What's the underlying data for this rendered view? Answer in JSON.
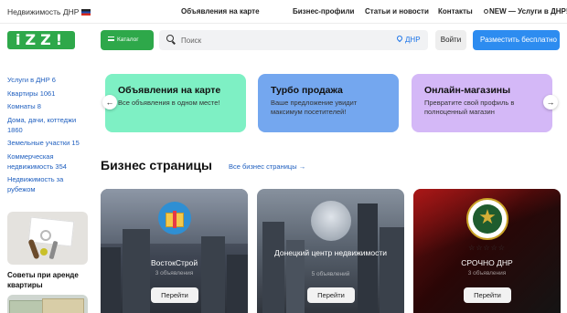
{
  "topbar": {
    "region": "Недвижимость ДНР",
    "nav": [
      "Объявления на карте",
      "Бизнес-профили",
      "Статьи и новости",
      "Контакты",
      "NEW — Услуги в ДНР!"
    ]
  },
  "header": {
    "logo": "iZZ!",
    "catalog": "Каталог",
    "search_placeholder": "Поиск",
    "location": "ДНР",
    "login": "Войти",
    "post": "Разместить бесплатно"
  },
  "sidebar": {
    "items": [
      "Услуги в ДНР 6",
      "Квартиры 1061",
      "Комнаты 8",
      "Дома, дачи, коттеджи 1860",
      "Земельные участки 15",
      "Коммерческая недвижимость 354",
      "Недвижимость за рубежом"
    ],
    "article_title": "Советы при аренде квартиры"
  },
  "promos": [
    {
      "title": "Объявления на карте",
      "text": "Все объявления в одном месте!",
      "color": "#7ef0c4"
    },
    {
      "title": "Турбо продажа",
      "text": "Ваше предложение увидит максимум посетителей!",
      "color": "#74a7ef"
    },
    {
      "title": "Онлайн-магазины",
      "text": "Превратите свой профиль в полноценный магазин",
      "color": "#d4b8f7"
    }
  ],
  "business": {
    "heading": "Бизнес страницы",
    "all_link": "Все бизнес страницы →",
    "cards": [
      {
        "name": "ВостокСтрой",
        "count": "3 объявления",
        "button": "Перейти"
      },
      {
        "name": "Донецкий центр недвижимости",
        "count": "5 объявлений",
        "button": "Перейти"
      },
      {
        "name": "СРОЧНО ДНР",
        "count": "3 объявления",
        "button": "Перейти"
      }
    ]
  },
  "icons": {
    "left_arrow": "←",
    "right_arrow": "→",
    "stars": "☆☆☆☆☆"
  }
}
